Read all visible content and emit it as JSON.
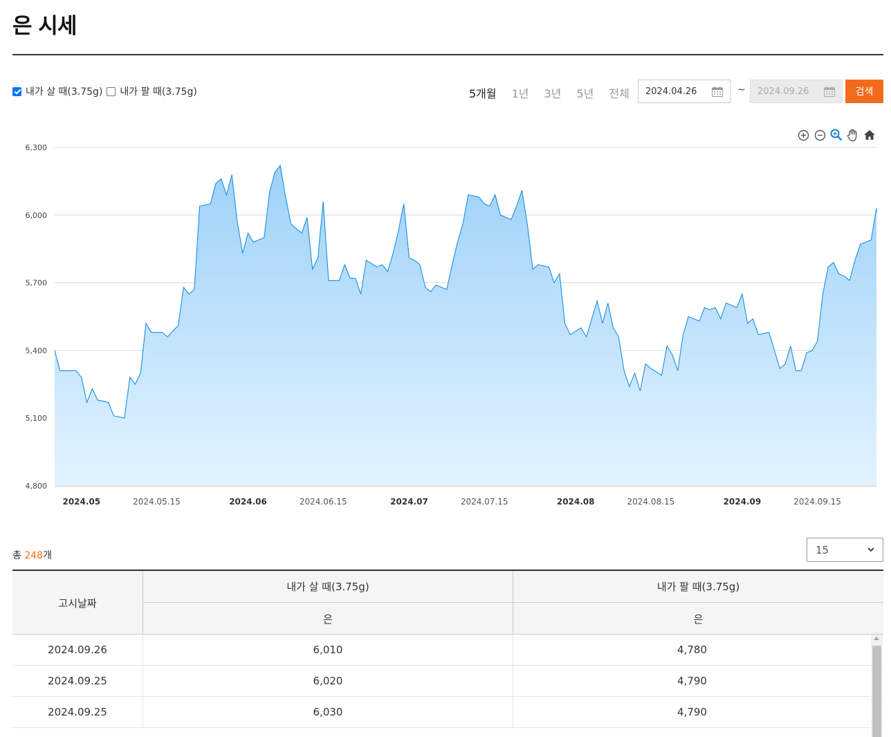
{
  "page": {
    "title": "은 시세"
  },
  "filters": {
    "buy_label": "내가 살 때(3.75g)",
    "buy_checked": true,
    "sell_label": "내가 팔 때(3.75g)",
    "sell_checked": false
  },
  "periods": [
    {
      "label": "5개월",
      "active": true
    },
    {
      "label": "1년",
      "active": false
    },
    {
      "label": "3년",
      "active": false
    },
    {
      "label": "5년",
      "active": false
    },
    {
      "label": "전체",
      "active": false
    }
  ],
  "date_range": {
    "start": "2024.04.26",
    "separator": "~",
    "end": "2024.09.26"
  },
  "search_label": "검색",
  "chart_tools": [
    "zoom-in-icon",
    "zoom-out-icon",
    "magnifier-icon",
    "pan-hand-icon",
    "home-icon"
  ],
  "colors": {
    "accent": "#f26b1d",
    "line": "#1a8fe6",
    "fill_top": "#9dd1f8",
    "fill_bottom": "#e3f3ff"
  },
  "chart_data": {
    "type": "area",
    "title": "",
    "xlabel": "",
    "ylabel": "",
    "ylim": [
      4800,
      6300
    ],
    "y_ticks": [
      4800,
      5100,
      5400,
      5700,
      6000,
      6300
    ],
    "y_tick_labels": [
      "4,800",
      "5,100",
      "5,400",
      "5,700",
      "6,000",
      "6,300"
    ],
    "x_range": [
      "2024-04-26",
      "2024-09-26"
    ],
    "x_ticks": [
      {
        "date": "2024-05-01",
        "label": "2024.05",
        "major": true
      },
      {
        "date": "2024-05-15",
        "label": "2024.05.15",
        "major": false
      },
      {
        "date": "2024-06-01",
        "label": "2024.06",
        "major": true
      },
      {
        "date": "2024-06-15",
        "label": "2024.06.15",
        "major": false
      },
      {
        "date": "2024-07-01",
        "label": "2024.07",
        "major": true
      },
      {
        "date": "2024-07-15",
        "label": "2024.07.15",
        "major": false
      },
      {
        "date": "2024-08-01",
        "label": "2024.08",
        "major": true
      },
      {
        "date": "2024-08-15",
        "label": "2024.08.15",
        "major": false
      },
      {
        "date": "2024-09-01",
        "label": "2024.09",
        "major": true
      },
      {
        "date": "2024-09-15",
        "label": "2024.09.15",
        "major": false
      }
    ],
    "grid": true,
    "series": [
      {
        "points": [
          [
            "2024-04-26",
            5400
          ],
          [
            "2024-04-27",
            5310
          ],
          [
            "2024-04-30",
            5310
          ],
          [
            "2024-05-01",
            5280
          ],
          [
            "2024-05-02",
            5170
          ],
          [
            "2024-05-03",
            5230
          ],
          [
            "2024-05-04",
            5180
          ],
          [
            "2024-05-06",
            5170
          ],
          [
            "2024-05-07",
            5110
          ],
          [
            "2024-05-09",
            5100
          ],
          [
            "2024-05-10",
            5280
          ],
          [
            "2024-05-11",
            5250
          ],
          [
            "2024-05-12",
            5300
          ],
          [
            "2024-05-13",
            5520
          ],
          [
            "2024-05-14",
            5480
          ],
          [
            "2024-05-16",
            5480
          ],
          [
            "2024-05-17",
            5460
          ],
          [
            "2024-05-19",
            5510
          ],
          [
            "2024-05-20",
            5680
          ],
          [
            "2024-05-21",
            5650
          ],
          [
            "2024-05-22",
            5670
          ],
          [
            "2024-05-23",
            6040
          ],
          [
            "2024-05-25",
            6050
          ],
          [
            "2024-05-26",
            6140
          ],
          [
            "2024-05-27",
            6160
          ],
          [
            "2024-05-28",
            6090
          ],
          [
            "2024-05-29",
            6180
          ],
          [
            "2024-05-30",
            5970
          ],
          [
            "2024-05-31",
            5830
          ],
          [
            "2024-06-01",
            5920
          ],
          [
            "2024-06-02",
            5880
          ],
          [
            "2024-06-04",
            5900
          ],
          [
            "2024-06-05",
            6100
          ],
          [
            "2024-06-06",
            6190
          ],
          [
            "2024-06-07",
            6220
          ],
          [
            "2024-06-08",
            6080
          ],
          [
            "2024-06-09",
            5960
          ],
          [
            "2024-06-11",
            5920
          ],
          [
            "2024-06-12",
            5990
          ],
          [
            "2024-06-13",
            5760
          ],
          [
            "2024-06-14",
            5810
          ],
          [
            "2024-06-15",
            6060
          ],
          [
            "2024-06-16",
            5710
          ],
          [
            "2024-06-18",
            5710
          ],
          [
            "2024-06-19",
            5780
          ],
          [
            "2024-06-20",
            5720
          ],
          [
            "2024-06-21",
            5720
          ],
          [
            "2024-06-22",
            5650
          ],
          [
            "2024-06-23",
            5800
          ],
          [
            "2024-06-25",
            5770
          ],
          [
            "2024-06-26",
            5780
          ],
          [
            "2024-06-27",
            5750
          ],
          [
            "2024-06-28",
            5830
          ],
          [
            "2024-06-29",
            5930
          ],
          [
            "2024-06-30",
            6050
          ],
          [
            "2024-07-01",
            5810
          ],
          [
            "2024-07-02",
            5800
          ],
          [
            "2024-07-03",
            5780
          ],
          [
            "2024-07-04",
            5680
          ],
          [
            "2024-07-05",
            5660
          ],
          [
            "2024-07-06",
            5690
          ],
          [
            "2024-07-08",
            5670
          ],
          [
            "2024-07-09",
            5780
          ],
          [
            "2024-07-10",
            5880
          ],
          [
            "2024-07-11",
            5960
          ],
          [
            "2024-07-12",
            6090
          ],
          [
            "2024-07-14",
            6080
          ],
          [
            "2024-07-15",
            6050
          ],
          [
            "2024-07-16",
            6040
          ],
          [
            "2024-07-17",
            6090
          ],
          [
            "2024-07-18",
            6000
          ],
          [
            "2024-07-20",
            5980
          ],
          [
            "2024-07-21",
            6040
          ],
          [
            "2024-07-22",
            6110
          ],
          [
            "2024-07-23",
            5960
          ],
          [
            "2024-07-24",
            5760
          ],
          [
            "2024-07-25",
            5780
          ],
          [
            "2024-07-27",
            5770
          ],
          [
            "2024-07-28",
            5700
          ],
          [
            "2024-07-29",
            5740
          ],
          [
            "2024-07-30",
            5520
          ],
          [
            "2024-07-31",
            5470
          ],
          [
            "2024-08-02",
            5500
          ],
          [
            "2024-08-03",
            5460
          ],
          [
            "2024-08-05",
            5620
          ],
          [
            "2024-08-06",
            5520
          ],
          [
            "2024-08-07",
            5610
          ],
          [
            "2024-08-08",
            5500
          ],
          [
            "2024-08-09",
            5460
          ],
          [
            "2024-08-10",
            5310
          ],
          [
            "2024-08-11",
            5240
          ],
          [
            "2024-08-12",
            5300
          ],
          [
            "2024-08-13",
            5220
          ],
          [
            "2024-08-14",
            5340
          ],
          [
            "2024-08-15",
            5320
          ],
          [
            "2024-08-17",
            5290
          ],
          [
            "2024-08-18",
            5420
          ],
          [
            "2024-08-19",
            5380
          ],
          [
            "2024-08-20",
            5310
          ],
          [
            "2024-08-21",
            5470
          ],
          [
            "2024-08-22",
            5550
          ],
          [
            "2024-08-24",
            5530
          ],
          [
            "2024-08-25",
            5590
          ],
          [
            "2024-08-26",
            5580
          ],
          [
            "2024-08-27",
            5590
          ],
          [
            "2024-08-28",
            5540
          ],
          [
            "2024-08-29",
            5610
          ],
          [
            "2024-08-31",
            5590
          ],
          [
            "2024-09-01",
            5650
          ],
          [
            "2024-09-02",
            5520
          ],
          [
            "2024-09-03",
            5540
          ],
          [
            "2024-09-04",
            5470
          ],
          [
            "2024-09-06",
            5480
          ],
          [
            "2024-09-07",
            5400
          ],
          [
            "2024-09-08",
            5320
          ],
          [
            "2024-09-09",
            5340
          ],
          [
            "2024-09-10",
            5420
          ],
          [
            "2024-09-11",
            5310
          ],
          [
            "2024-09-12",
            5310
          ],
          [
            "2024-09-13",
            5390
          ],
          [
            "2024-09-14",
            5400
          ],
          [
            "2024-09-15",
            5440
          ],
          [
            "2024-09-16",
            5650
          ],
          [
            "2024-09-17",
            5770
          ],
          [
            "2024-09-18",
            5790
          ],
          [
            "2024-09-19",
            5740
          ],
          [
            "2024-09-20",
            5730
          ],
          [
            "2024-09-21",
            5710
          ],
          [
            "2024-09-22",
            5800
          ],
          [
            "2024-09-23",
            5870
          ],
          [
            "2024-09-24",
            5880
          ],
          [
            "2024-09-25",
            5890
          ],
          [
            "2024-09-26",
            6030
          ],
          [
            "2024-09-26",
            6010
          ]
        ]
      }
    ]
  },
  "summary": {
    "prefix": "총 ",
    "count": "248",
    "suffix": "개"
  },
  "page_size": {
    "value": "15"
  },
  "table": {
    "headers": {
      "date": "고시날짜",
      "buy": "내가 살 때(3.75g)",
      "sell": "내가 팔 때(3.75g)",
      "buy_sub": "은",
      "sell_sub": "은"
    },
    "rows": [
      {
        "date": "2024.09.26",
        "buy": "6,010",
        "sell": "4,780"
      },
      {
        "date": "2024.09.25",
        "buy": "6,020",
        "sell": "4,790"
      },
      {
        "date": "2024.09.25",
        "buy": "6,030",
        "sell": "4,790"
      }
    ]
  }
}
